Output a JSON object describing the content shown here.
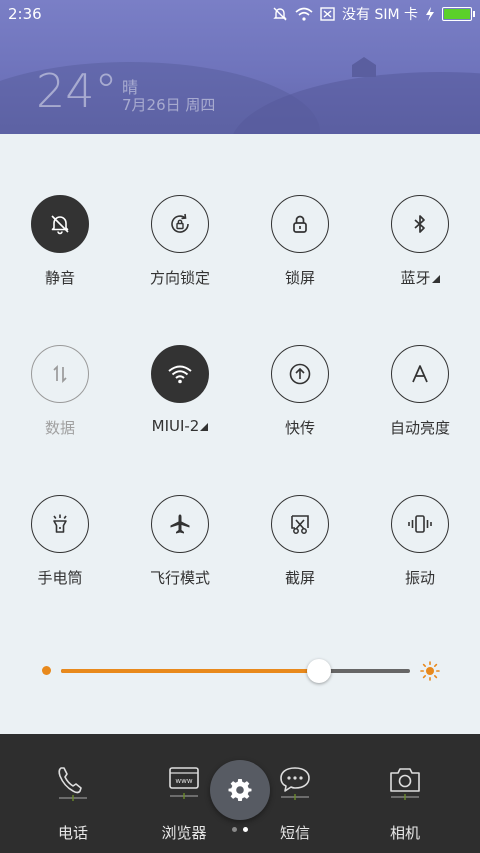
{
  "status_bar": {
    "time": "2:36",
    "carrier_text": "没有 SIM 卡",
    "battery_percent": 100
  },
  "weather": {
    "temperature": "24°",
    "condition": "晴",
    "date": "7月26日 周四"
  },
  "quick_settings": {
    "tiles": [
      {
        "label": "静音",
        "icon": "bell-off-icon",
        "state": "on"
      },
      {
        "label": "方向锁定",
        "icon": "rotation-lock-icon",
        "state": "off"
      },
      {
        "label": "锁屏",
        "icon": "lock-icon",
        "state": "off"
      },
      {
        "label": "蓝牙",
        "icon": "bluetooth-icon",
        "state": "off",
        "expandable": true
      },
      {
        "label": "数据",
        "icon": "mobile-data-icon",
        "state": "disabled"
      },
      {
        "label": "MIUI-2",
        "icon": "wifi-icon",
        "state": "on",
        "expandable": true
      },
      {
        "label": "快传",
        "icon": "upload-icon",
        "state": "off"
      },
      {
        "label": "自动亮度",
        "icon": "auto-brightness-icon",
        "state": "off"
      },
      {
        "label": "手电筒",
        "icon": "flashlight-icon",
        "state": "off"
      },
      {
        "label": "飞行模式",
        "icon": "airplane-icon",
        "state": "off"
      },
      {
        "label": "截屏",
        "icon": "screenshot-icon",
        "state": "off"
      },
      {
        "label": "振动",
        "icon": "vibrate-icon",
        "state": "off"
      }
    ]
  },
  "brightness": {
    "level": 0.74,
    "accent": "#e8891c"
  },
  "dock": {
    "items": [
      {
        "label": "电话",
        "icon": "phone-icon"
      },
      {
        "label": "浏览器",
        "icon": "browser-icon"
      },
      {
        "label": "短信",
        "icon": "message-icon"
      },
      {
        "label": "相机",
        "icon": "camera-icon"
      }
    ],
    "page_count": 2,
    "active_page": 2
  },
  "colors": {
    "panel_bg": "#ebf1f4",
    "tile_on": "#333333",
    "battery": "#5bd02a",
    "wallpaper": "#7a7fc6"
  }
}
